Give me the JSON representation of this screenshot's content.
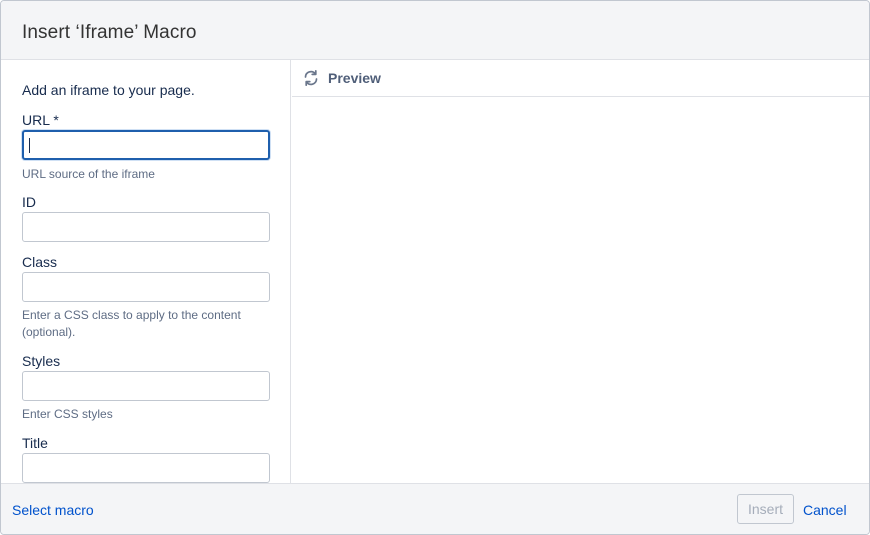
{
  "dialog": {
    "title": "Insert ‘Iframe’ Macro"
  },
  "form": {
    "intro": "Add an iframe to your page.",
    "fields": [
      {
        "label": "URL *",
        "value": "",
        "help": "URL source of the iframe"
      },
      {
        "label": "ID",
        "value": "",
        "help": ""
      },
      {
        "label": "Class",
        "value": "",
        "help": "Enter a CSS class to apply to the content (optional)."
      },
      {
        "label": "Styles",
        "value": "",
        "help": "Enter CSS styles"
      },
      {
        "label": "Title",
        "value": "",
        "help": ""
      }
    ]
  },
  "preview": {
    "label": "Preview",
    "icon": "refresh-icon"
  },
  "footer": {
    "select_macro": "Select macro",
    "insert": "Insert",
    "cancel": "Cancel"
  },
  "colors": {
    "link": "#0052cc",
    "focus_border": "#1f5fad",
    "header_bg": "#f4f5f7",
    "disabled_text": "#a5adba"
  }
}
